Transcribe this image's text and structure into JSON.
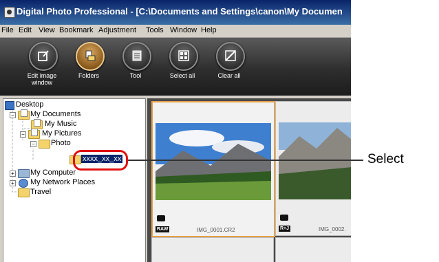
{
  "window": {
    "title": "Digital Photo Professional - [C:\\Documents and Settings\\canon\\My Documen"
  },
  "menu": [
    "File",
    "Edit",
    "View",
    "Bookmark",
    "Adjustment",
    "Tools",
    "Window",
    "Help"
  ],
  "toolbar": {
    "buttons": [
      {
        "label": "Edit image window",
        "icon": "edit-image-icon"
      },
      {
        "label": "Folders",
        "icon": "folders-icon",
        "active": true
      },
      {
        "label": "Tool",
        "icon": "tool-icon"
      },
      {
        "label": "Select all",
        "icon": "select-all-icon"
      },
      {
        "label": "Clear all",
        "icon": "clear-all-icon"
      }
    ]
  },
  "tree": {
    "desktop": "Desktop",
    "my_documents": "My Documents",
    "my_music": "My Music",
    "my_pictures": "My Pictures",
    "photo": "Photo",
    "selected_folder": "xxxx_xx_xx",
    "my_computer": "My Computer",
    "my_network_places": "My Network Places",
    "travel": "Travel"
  },
  "thumbnails": [
    {
      "filename": "IMG_0001.CR2",
      "badge": "RAW",
      "selected": true
    },
    {
      "filename": "IMG_0002.",
      "badge": "R+J",
      "selected": false
    }
  ],
  "callout": {
    "label": "Select"
  },
  "colors": {
    "selection_border": "#e6a04a",
    "callout_ring": "#e01010",
    "title_bar": "#0a246a"
  }
}
